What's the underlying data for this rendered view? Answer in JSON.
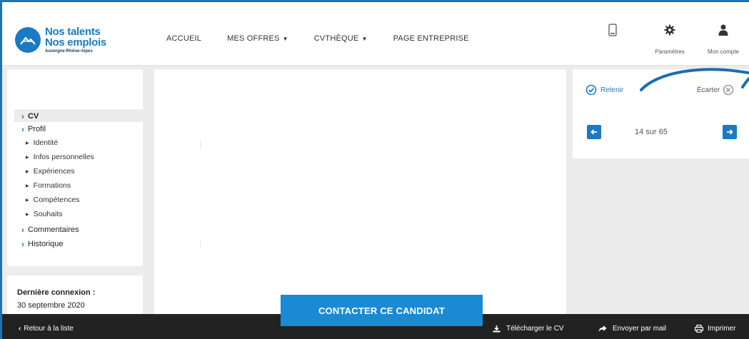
{
  "logo": {
    "line1": "Nos talents",
    "line2": "Nos emplois",
    "line3": "Auvergne-Rhône-Alpes"
  },
  "nav": {
    "items": [
      {
        "label": "ACCUEIL",
        "dropdown": false
      },
      {
        "label": "MES OFFRES",
        "dropdown": true
      },
      {
        "label": "CVTHÈQUE",
        "dropdown": true
      },
      {
        "label": "PAGE ENTREPRISE",
        "dropdown": false
      }
    ]
  },
  "header_actions": {
    "settings_label": "Paramètres",
    "account_label": "Mon compte"
  },
  "sidebar": {
    "items": [
      {
        "label": "CV"
      },
      {
        "label": "Profil"
      }
    ],
    "sub_items": [
      {
        "label": "Identité"
      },
      {
        "label": "Infos personnelles"
      },
      {
        "label": "Expériences"
      },
      {
        "label": "Formations"
      },
      {
        "label": "Compétences"
      },
      {
        "label": "Souhaits"
      }
    ],
    "bottom_items": [
      {
        "label": "Commentaires"
      },
      {
        "label": "Historique"
      }
    ]
  },
  "last_login": {
    "title": "Dernière connexion :",
    "date": "30 septembre 2020"
  },
  "candidate_actions": {
    "retain_label": "Retenir",
    "discard_label": "Écarter",
    "pager_text": "14 sur 65"
  },
  "contact_button": "CONTACTER CE CANDIDAT",
  "bottom_bar": {
    "back_label": "Retour à la liste",
    "download_label": "Télécharger le CV",
    "send_label": "Envoyer par mail",
    "print_label": "Imprimer"
  },
  "colors": {
    "accent": "#1a7ac4",
    "button": "#1a8ad4",
    "bottom_bar": "#222222",
    "panel_bg": "#ececec"
  }
}
